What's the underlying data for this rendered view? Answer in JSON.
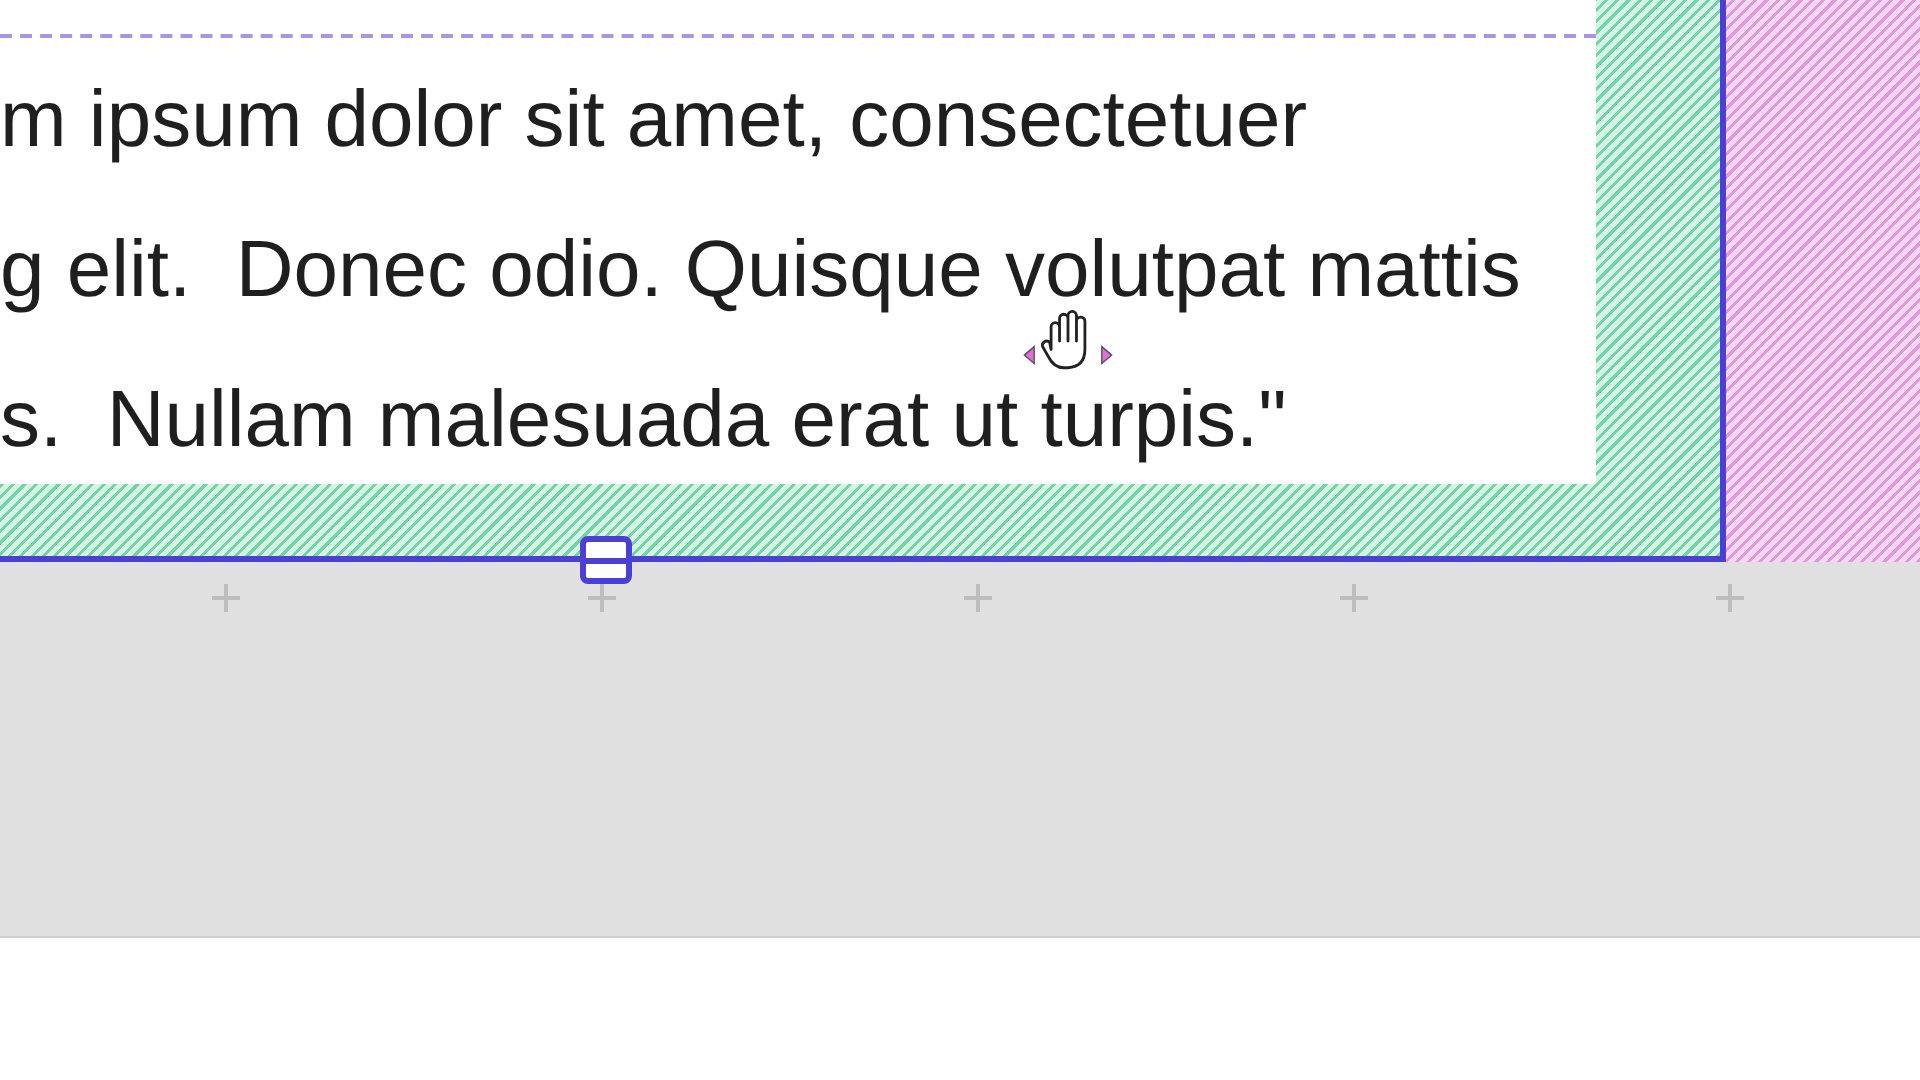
{
  "frame": {
    "text_lines": [
      "m ipsum dolor sit amet, consectetuer",
      "g elit.  Donec odio. Quisque volutpat mattis",
      "s.  Nullam malesuada erat ut turpis.\""
    ]
  }
}
